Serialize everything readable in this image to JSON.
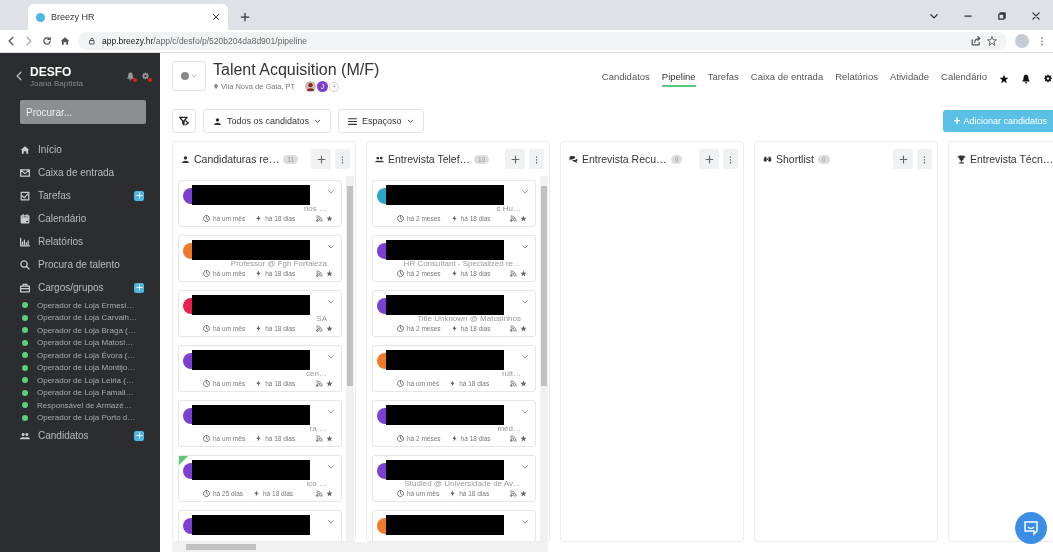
{
  "browser": {
    "tab_title": "Breezy HR",
    "url_host": "app.breezy.hr",
    "url_path": "/app/c/desfo/p/520b204da8d901/pipeline"
  },
  "sidebar": {
    "company": "DESFO",
    "user": "Joana Baptista",
    "search_placeholder": "Procurar...",
    "items": [
      {
        "label": "Início",
        "add": false
      },
      {
        "label": "Caixa de entrada",
        "add": false
      },
      {
        "label": "Tarefas",
        "add": true
      },
      {
        "label": "Calendário",
        "add": false
      },
      {
        "label": "Relatórios",
        "add": false
      },
      {
        "label": "Procura de talento",
        "add": false
      },
      {
        "label": "Cargos/grupos",
        "add": true,
        "children": [
          {
            "label": "Operador de Loja Ermesi…"
          },
          {
            "label": "Operador de Loja Carvalh…"
          },
          {
            "label": "Operador de Loja Braga (…"
          },
          {
            "label": "Operador de Loja Matosi…"
          },
          {
            "label": "Operador de Loja Évora (…"
          },
          {
            "label": "Operador de Loja Montijo…"
          },
          {
            "label": "Operador de Loja Leiria (…"
          },
          {
            "label": "Operador de Loja Famali…"
          },
          {
            "label": "Responsável de Armazé…"
          },
          {
            "label": "Operador de Loja Porto d…"
          }
        ]
      },
      {
        "label": "Candidatos",
        "add": true
      }
    ]
  },
  "job": {
    "title": "Talent Acquisition (M/F)",
    "location": "Vila Nova de Gaia, PT",
    "team": [
      {
        "kind": "photo"
      },
      {
        "kind": "initial",
        "text": "J"
      },
      {
        "kind": "add",
        "text": "+"
      }
    ]
  },
  "nav_tabs": [
    {
      "label": "Candidatos",
      "selected": false
    },
    {
      "label": "Pipeline",
      "selected": true
    },
    {
      "label": "Tarefas",
      "selected": false
    },
    {
      "label": "Caixa de entrada",
      "selected": false
    },
    {
      "label": "Relatórios",
      "selected": false
    },
    {
      "label": "Atividade",
      "selected": false
    },
    {
      "label": "Calendário",
      "selected": false
    }
  ],
  "toolbar": {
    "filters": [
      {
        "label": "Todos os candidatos"
      },
      {
        "label": "Espaçoso"
      }
    ],
    "add_button": {
      "icon": "+",
      "label": "Adicionar candidatos"
    }
  },
  "stages": [
    {
      "title": "Candidaturas re…",
      "count": "11",
      "controls": true,
      "cards": [
        {
          "color": "#7b3fd1",
          "subtitle": "nos …",
          "applied": "há um mês",
          "moved": "há 18 dias",
          "flagged": false
        },
        {
          "color": "#f07a2a",
          "subtitle": "Professor @ Fgh Fortaleza",
          "applied": "há um mês",
          "moved": "há 18 dias",
          "flagged": false
        },
        {
          "color": "#e8204a",
          "subtitle": "SA",
          "applied": "há um mês",
          "moved": "há 18 dias",
          "flagged": false
        },
        {
          "color": "#7b3fd1",
          "subtitle": "cen…",
          "applied": "há um mês",
          "moved": "há 18 dias",
          "flagged": false
        },
        {
          "color": "#7b3fd1",
          "subtitle": "ra …",
          "applied": "há um mês",
          "moved": "há 18 dias",
          "flagged": false
        },
        {
          "color": "#7b3fd1",
          "subtitle": "ico …",
          "applied": "há 25 dias",
          "moved": "há 18 dias",
          "flagged": true
        },
        {
          "color": "#7b3fd1",
          "flagged": false
        }
      ]
    },
    {
      "title": "Entrevista Telef…",
      "count": "10",
      "controls": true,
      "cards": [
        {
          "color": "#2aa6c9",
          "subtitle": "s Hu…",
          "applied": "há 2 meses",
          "moved": "há 18 dias",
          "flagged": false
        },
        {
          "color": "#7b3fd1",
          "subtitle": "HR Consultant - Specialized re…",
          "applied": "há 2 meses",
          "moved": "há 18 dias",
          "flagged": false
        },
        {
          "color": "#7b3fd1",
          "subtitle": "Title Unknown @ Matosinhos",
          "applied": "há 2 meses",
          "moved": "há 18 dias",
          "flagged": false
        },
        {
          "color": "#f07a2a",
          "subtitle": "ruit…",
          "applied": "há um mês",
          "moved": "há 18 dias",
          "flagged": false
        },
        {
          "color": "#7b3fd1",
          "subtitle": "méd…",
          "applied": "há 2 meses",
          "moved": "há 18 dias",
          "flagged": false
        },
        {
          "color": "#7b3fd1",
          "subtitle": "Studied @ Universidade de Av…",
          "applied": "há um mês",
          "moved": "há 18 dias",
          "flagged": false
        },
        {
          "color": "#f07a2a",
          "flagged": false
        }
      ]
    },
    {
      "title": "Entrevista Recu…",
      "count": "0",
      "controls": true
    },
    {
      "title": "Shortlist",
      "count": "0",
      "controls": true
    },
    {
      "title": "Entrevista Técn…",
      "controls": false
    }
  ]
}
